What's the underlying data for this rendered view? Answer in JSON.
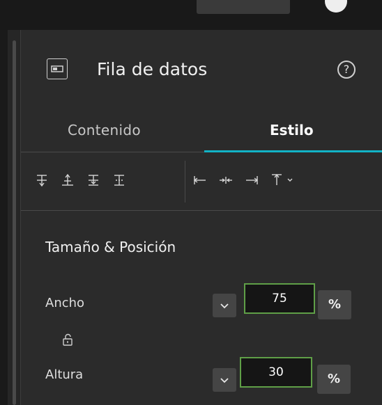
{
  "header": {
    "title": "Fila de datos",
    "help_symbol": "?",
    "icon": "data-row-icon"
  },
  "tabs": [
    {
      "label": "Contenido",
      "active": false
    },
    {
      "label": "Estilo",
      "active": true
    }
  ],
  "toolbar": {
    "tools": [
      {
        "name": "align-top-icon",
        "label": "Alinear arriba"
      },
      {
        "name": "align-vertical-center-icon",
        "label": "Centrar verticalmente"
      },
      {
        "name": "align-bottom-icon",
        "label": "Alinear abajo"
      },
      {
        "name": "distribute-vertical-icon",
        "label": "Distribuir verticalmente"
      },
      {
        "name": "align-left-icon",
        "label": "Alinear a la izquierda"
      },
      {
        "name": "align-horizontal-center-icon",
        "label": "Centrar horizontalmente"
      },
      {
        "name": "align-right-icon",
        "label": "Alinear a la derecha"
      },
      {
        "name": "align-top-dropdown-icon",
        "label": "Más alineación"
      }
    ]
  },
  "size_position": {
    "title": "Tamaño & Posición",
    "width": {
      "label": "Ancho",
      "value": "75",
      "unit": "%"
    },
    "height": {
      "label": "Altura",
      "value": "30",
      "unit": "%"
    },
    "lock_icon": "unlock-icon"
  },
  "colors": {
    "accent": "#12b3c6",
    "focus_border": "#5f9f47",
    "panel_bg": "#2b2b2b"
  }
}
